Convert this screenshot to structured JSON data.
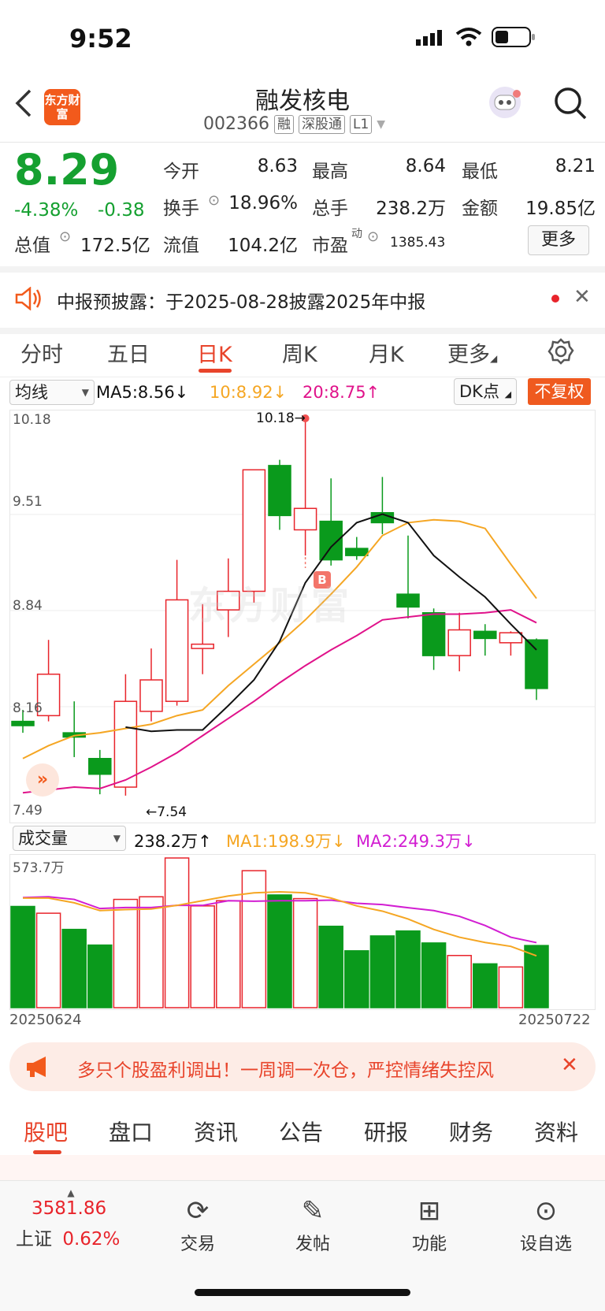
{
  "status": {
    "time": "9:52"
  },
  "header": {
    "stock_name": "融发核电",
    "code": "002366",
    "tags": [
      "融",
      "深股通",
      "L1"
    ],
    "logo_text": "东方财富"
  },
  "quote": {
    "price": "8.29",
    "change_pct": "-4.38%",
    "change": "-0.38",
    "open_label": "今开",
    "open": "8.63",
    "high_label": "最高",
    "high": "8.64",
    "low_label": "最低",
    "low": "8.21",
    "turnover_label": "换手",
    "turnover": "18.96%",
    "volume_label": "总手",
    "volume": "238.2万",
    "amount_label": "金额",
    "amount": "19.85亿",
    "total_mv_label": "总值",
    "total_mv": "172.5亿",
    "float_mv_label": "流值",
    "float_mv": "104.2亿",
    "pe_label": "市盈",
    "pe_sup": "动",
    "pe": "1385.43",
    "more_label": "更多"
  },
  "notice": {
    "text": "中报预披露：于2025-08-28披露2025年中报"
  },
  "tabs": [
    "分时",
    "五日",
    "日K",
    "周K",
    "月K",
    "更多"
  ],
  "active_tab": "日K",
  "chart_head": {
    "indicator": "均线",
    "ma5": "MA5:8.56↓",
    "ma10": "10:8.92↓",
    "ma20": "20:8.75↑",
    "dk": "DK点",
    "adjust": "不复权"
  },
  "chart_labels": {
    "y_ticks": [
      "10.18",
      "9.51",
      "8.84",
      "8.16",
      "7.49"
    ],
    "high_marker": "10.18→",
    "low_marker": "←7.54",
    "b_marker": "B",
    "watermark": "东方财富",
    "date_start": "20250624",
    "date_end": "20250722"
  },
  "vol_head": {
    "indicator": "成交量",
    "vol": "238.2万↑",
    "ma1": "MA1:198.9万↓",
    "ma2": "MA2:249.3万↓",
    "max": "573.7万"
  },
  "colors": {
    "up": "#e8242b",
    "down": "#0a9a1c",
    "ma5": "#111111",
    "ma10": "#f5a623",
    "ma20": "#e0128a",
    "accent": "#f25a1c"
  },
  "chart_data": {
    "type": "candlestick",
    "ylim": [
      7.49,
      10.18
    ],
    "candles": [
      {
        "o": 8.06,
        "c": 8.03,
        "h": 8.14,
        "l": 7.98
      },
      {
        "o": 8.1,
        "c": 8.39,
        "h": 8.63,
        "l": 8.06
      },
      {
        "o": 7.98,
        "c": 7.95,
        "h": 8.2,
        "l": 7.81
      },
      {
        "o": 7.8,
        "c": 7.69,
        "h": 7.86,
        "l": 7.55
      },
      {
        "o": 7.6,
        "c": 8.2,
        "h": 8.39,
        "l": 7.54
      },
      {
        "o": 8.13,
        "c": 8.35,
        "h": 8.57,
        "l": 8.06
      },
      {
        "o": 8.2,
        "c": 8.91,
        "h": 9.19,
        "l": 8.17
      },
      {
        "o": 8.57,
        "c": 8.6,
        "h": 8.88,
        "l": 8.39
      },
      {
        "o": 8.84,
        "c": 8.97,
        "h": 9.2,
        "l": 8.65
      },
      {
        "o": 8.97,
        "c": 9.82,
        "h": 9.82,
        "l": 8.89
      },
      {
        "o": 9.85,
        "c": 9.5,
        "h": 9.89,
        "l": 9.4
      },
      {
        "o": 9.4,
        "c": 9.55,
        "h": 10.18,
        "l": 9.22
      },
      {
        "o": 9.46,
        "c": 9.19,
        "h": 9.76,
        "l": 9.15
      },
      {
        "o": 9.27,
        "c": 9.22,
        "h": 9.35,
        "l": 9.19
      },
      {
        "o": 9.52,
        "c": 9.45,
        "h": 9.77,
        "l": 9.37
      },
      {
        "o": 8.95,
        "c": 8.86,
        "h": 9.36,
        "l": 8.78
      },
      {
        "o": 8.82,
        "c": 8.52,
        "h": 8.85,
        "l": 8.42
      },
      {
        "o": 8.52,
        "c": 8.7,
        "h": 8.82,
        "l": 8.41
      },
      {
        "o": 8.69,
        "c": 8.64,
        "h": 8.74,
        "l": 8.52
      },
      {
        "o": 8.61,
        "c": 8.68,
        "h": 8.69,
        "l": 8.52
      },
      {
        "o": 8.63,
        "c": 8.29,
        "h": 8.64,
        "l": 8.21
      }
    ],
    "ma5": [
      null,
      null,
      null,
      null,
      8.02,
      7.99,
      8.0,
      8.0,
      8.17,
      8.35,
      8.62,
      9.03,
      9.28,
      9.45,
      9.51,
      9.45,
      9.22,
      9.07,
      8.93,
      8.74,
      8.56
    ],
    "ma10": [
      7.8,
      7.89,
      7.96,
      7.98,
      8.01,
      8.04,
      8.1,
      8.14,
      8.31,
      8.46,
      8.61,
      8.77,
      8.95,
      9.14,
      9.36,
      9.45,
      9.47,
      9.46,
      9.41,
      9.16,
      8.92
    ],
    "ma20": [
      7.56,
      7.58,
      7.6,
      7.59,
      7.65,
      7.74,
      7.84,
      7.96,
      8.08,
      8.2,
      8.33,
      8.45,
      8.56,
      8.66,
      8.77,
      8.79,
      8.81,
      8.81,
      8.82,
      8.84,
      8.75
    ],
    "volume": {
      "ylim": [
        0,
        573.7
      ],
      "values": [
        388,
        362,
        300,
        240,
        415,
        425,
        573.7,
        390,
        410,
        525,
        432,
        418,
        312,
        218,
        275,
        294,
        248,
        200,
        168,
        156,
        238.2
      ],
      "ma1": [
        420,
        420,
        402,
        372,
        376,
        378,
        392,
        410,
        428,
        440,
        444,
        440,
        420,
        390,
        370,
        340,
        300,
        270,
        250,
        235,
        198.9
      ],
      "ma2": [
        422,
        425,
        415,
        380,
        384,
        384,
        392,
        392,
        410,
        408,
        410,
        410,
        412,
        400,
        395,
        383,
        372,
        350,
        315,
        270,
        249.3
      ]
    },
    "x_range": [
      "20250624",
      "20250722"
    ]
  },
  "banner": {
    "text": "多只个股盈利调出！一周调一次仓，严控情绪失控风"
  },
  "subtabs": [
    "股吧",
    "盘口",
    "资讯",
    "公告",
    "研报",
    "财务",
    "资料"
  ],
  "index": {
    "value": "3581.86",
    "name": "上证",
    "pct": "0.62%"
  },
  "bottom": [
    {
      "label": "交易",
      "icon": "¥"
    },
    {
      "label": "发帖",
      "icon": "✎"
    },
    {
      "label": "功能",
      "icon": "⊞"
    },
    {
      "label": "设自选",
      "icon": "⋯"
    }
  ]
}
